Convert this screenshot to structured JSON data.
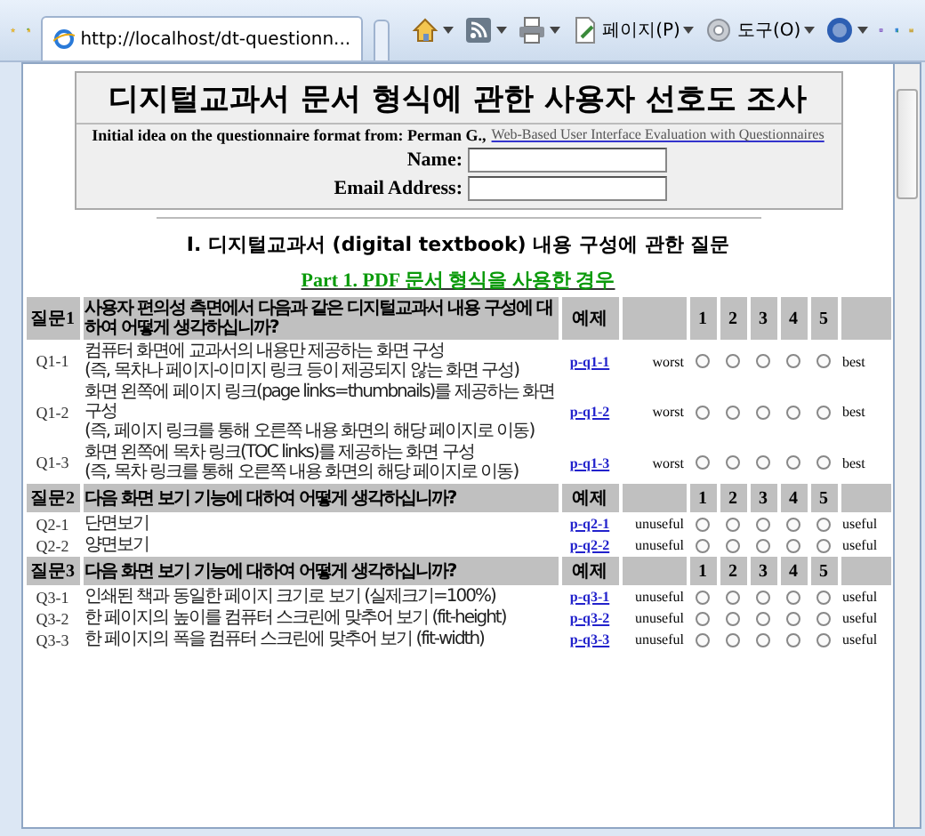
{
  "browser": {
    "tab": {
      "title": "http://localhost/dt-questionn...",
      "selected": true
    },
    "menus": [
      {
        "kind": "home"
      },
      {
        "kind": "feed"
      },
      {
        "kind": "print"
      },
      {
        "kind": "page",
        "label": "페이지(P)"
      },
      {
        "kind": "tools",
        "label": "도구(O)"
      },
      {
        "kind": "help"
      }
    ]
  },
  "survey": {
    "title": "디지털교과서 문서 형식에 관한 사용자 선호도 조사",
    "credit": "Initial idea on the questionnaire format from: Perman G.,",
    "credit_link": "Web-Based User Interface Evaluation with Questionnaires",
    "fields": [
      {
        "label": "Name:"
      },
      {
        "label": "Email Address:"
      }
    ],
    "section_heading": "I. 디지털교과서 (digital textbook) 내용 구성에 관한 질문",
    "part_heading": "Part 1. PDF 문서 형식을 사용한 경우",
    "groups": [
      {
        "id": "질문1",
        "question": "사용자 편의성 측면에서 다음과 같은 디지털교과서 내용 구성에 대하여 어떻게 생각하십니까?",
        "example_header": "예제",
        "scale": [
          "1",
          "2",
          "3",
          "4",
          "5"
        ],
        "items": [
          {
            "id": "Q1-1",
            "lines": [
              "컴퓨터 화면에 교과서의 내용만 제공하는 화면 구성",
              "(즉, 목차나 페이지-이미지 링크 등이 제공되지 않는 화면 구성)"
            ],
            "example": "p-q1-1",
            "low": "worst",
            "high": "best",
            "ratings": [
              {
                "selected": false
              },
              {
                "selected": false
              },
              {
                "selected": false
              },
              {
                "selected": false
              },
              {
                "selected": false
              }
            ]
          },
          {
            "id": "Q1-2",
            "lines": [
              "화면 왼쪽에 페이지 링크(page links=thumbnails)를 제공하는 화면 구성",
              "(즉, 페이지 링크를 통해 오른쪽 내용 화면의 해당 페이지로 이동)"
            ],
            "example": "p-q1-2",
            "low": "worst",
            "high": "best",
            "ratings": [
              {
                "selected": false
              },
              {
                "selected": false
              },
              {
                "selected": false
              },
              {
                "selected": false
              },
              {
                "selected": false
              }
            ]
          },
          {
            "id": "Q1-3",
            "lines": [
              "화면 왼쪽에 목차 링크(TOC links)를 제공하는 화면 구성",
              "(즉, 목차 링크를 통해 오른쪽 내용 화면의 해당 페이지로 이동)"
            ],
            "example": "p-q1-3",
            "low": "worst",
            "high": "best",
            "ratings": [
              {
                "selected": false
              },
              {
                "selected": false
              },
              {
                "selected": false
              },
              {
                "selected": false
              },
              {
                "selected": false
              }
            ]
          }
        ]
      },
      {
        "id": "질문2",
        "question": "다음 화면 보기 기능에 대하여 어떻게 생각하십니까?",
        "example_header": "예제",
        "scale": [
          "1",
          "2",
          "3",
          "4",
          "5"
        ],
        "items": [
          {
            "id": "Q2-1",
            "lines": [
              "단면보기"
            ],
            "example": "p-q2-1",
            "low": "unuseful",
            "high": "useful",
            "ratings": [
              {
                "selected": false
              },
              {
                "selected": false
              },
              {
                "selected": false
              },
              {
                "selected": false
              },
              {
                "selected": false
              }
            ]
          },
          {
            "id": "Q2-2",
            "lines": [
              "양면보기"
            ],
            "example": "p-q2-2",
            "low": "unuseful",
            "high": "useful",
            "ratings": [
              {
                "selected": false
              },
              {
                "selected": false
              },
              {
                "selected": false
              },
              {
                "selected": false
              },
              {
                "selected": false
              }
            ]
          }
        ]
      },
      {
        "id": "질문3",
        "question": "다음 화면 보기 기능에 대하여 어떻게 생각하십니까?",
        "example_header": "예제",
        "scale": [
          "1",
          "2",
          "3",
          "4",
          "5"
        ],
        "items": [
          {
            "id": "Q3-1",
            "lines": [
              "인쇄된 책과 동일한 페이지 크기로 보기 (실제크기=100%)"
            ],
            "example": "p-q3-1",
            "low": "unuseful",
            "high": "useful",
            "ratings": [
              {
                "selected": false
              },
              {
                "selected": false
              },
              {
                "selected": false
              },
              {
                "selected": false
              },
              {
                "selected": false
              }
            ]
          },
          {
            "id": "Q3-2",
            "lines": [
              "한 페이지의 높이를 컴퓨터 스크린에 맞추어 보기 (fit-height)"
            ],
            "example": "p-q3-2",
            "low": "unuseful",
            "high": "useful",
            "ratings": [
              {
                "selected": false
              },
              {
                "selected": false
              },
              {
                "selected": false
              },
              {
                "selected": false
              },
              {
                "selected": false
              }
            ]
          },
          {
            "id": "Q3-3",
            "lines": [
              "한 페이지의 폭을 컴퓨터 스크린에 맞추어 보기 (fit-width)"
            ],
            "example": "p-q3-3",
            "low": "unuseful",
            "high": "useful",
            "ratings": [
              {
                "selected": false
              },
              {
                "selected": false
              },
              {
                "selected": false
              },
              {
                "selected": false
              },
              {
                "selected": false
              }
            ]
          }
        ]
      }
    ]
  }
}
